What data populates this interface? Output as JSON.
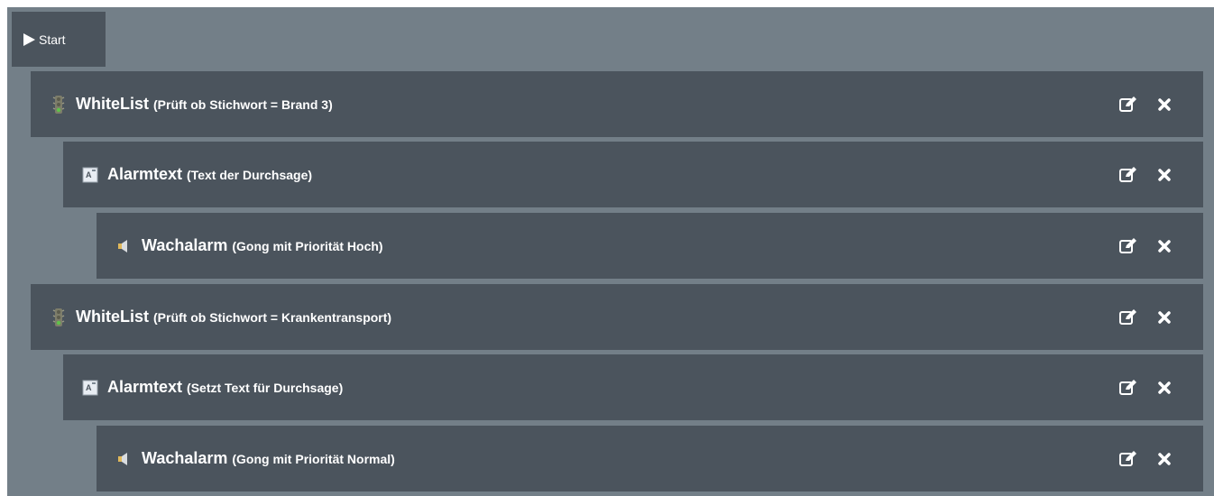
{
  "start": {
    "label": "Start"
  },
  "rows": [
    {
      "title": "WhiteList",
      "desc": "(Prüft ob Stichwort = Brand 3)",
      "icon": "traffic-light-icon"
    },
    {
      "title": "Alarmtext",
      "desc": "(Text der Durchsage)",
      "icon": "text-document-icon"
    },
    {
      "title": "Wachalarm",
      "desc": "(Gong mit Priorität Hoch)",
      "icon": "speaker-icon"
    },
    {
      "title": "WhiteList",
      "desc": "(Prüft ob Stichwort = Krankentransport)",
      "icon": "traffic-light-icon"
    },
    {
      "title": "Alarmtext",
      "desc": "(Setzt Text für Durchsage)",
      "icon": "text-document-icon"
    },
    {
      "title": "Wachalarm",
      "desc": "(Gong mit Priorität Normal)",
      "icon": "speaker-icon"
    }
  ],
  "colors": {
    "background": "#737f88",
    "row": "#4b545d",
    "text": "#ffffff"
  }
}
